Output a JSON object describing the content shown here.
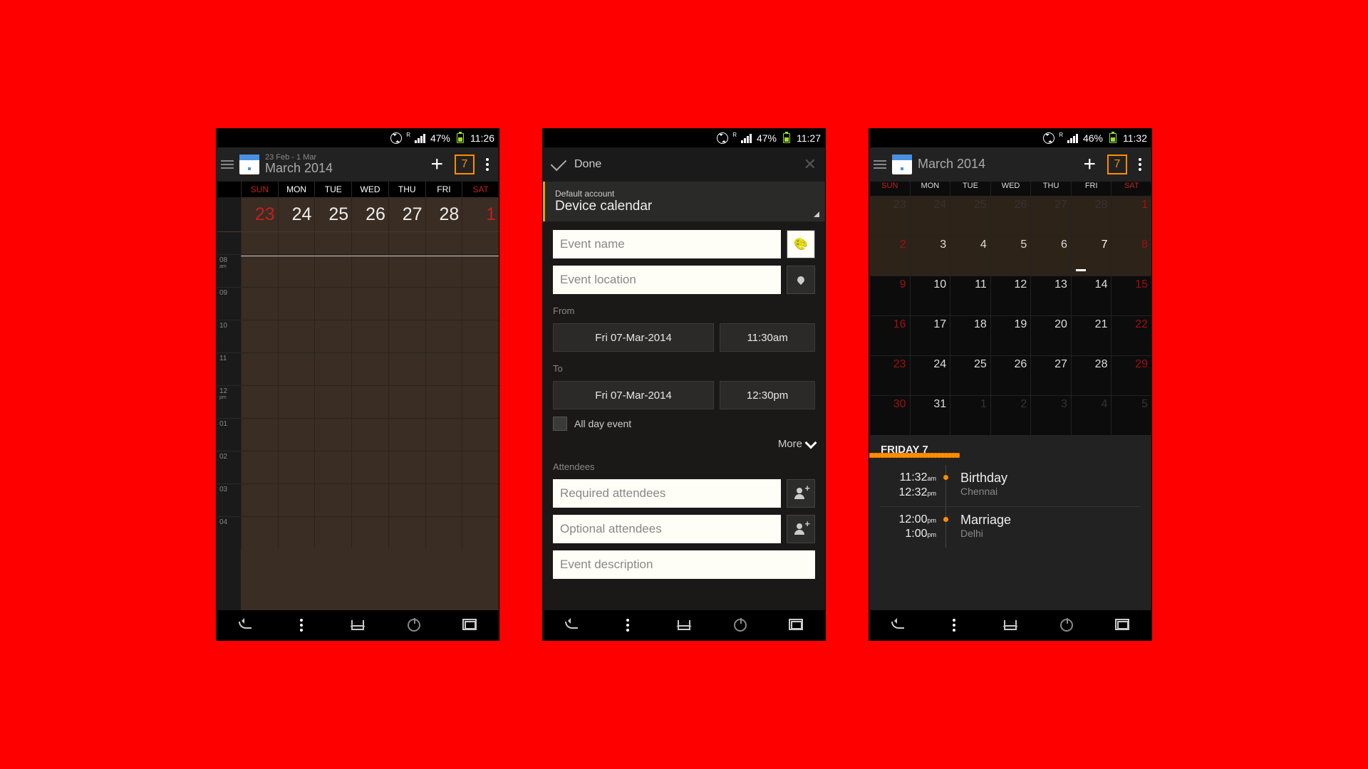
{
  "screen1": {
    "status": {
      "battery": "47%",
      "time": "11:26"
    },
    "header": {
      "sub": "23 Feb - 1 Mar",
      "main": "March 2014",
      "today": "7"
    },
    "days": [
      "SUN",
      "MON",
      "TUE",
      "WED",
      "THU",
      "FRI",
      "SAT"
    ],
    "dates": [
      "23",
      "24",
      "25",
      "26",
      "27",
      "28",
      "1"
    ],
    "hours": [
      {
        "h": "08",
        "ap": "am"
      },
      {
        "h": "09",
        "ap": ""
      },
      {
        "h": "10",
        "ap": ""
      },
      {
        "h": "11",
        "ap": ""
      },
      {
        "h": "12",
        "ap": "pm"
      },
      {
        "h": "01",
        "ap": ""
      },
      {
        "h": "02",
        "ap": ""
      },
      {
        "h": "03",
        "ap": ""
      },
      {
        "h": "04",
        "ap": ""
      }
    ]
  },
  "screen2": {
    "status": {
      "battery": "47%",
      "time": "11:27"
    },
    "done": "Done",
    "account_label": "Default account",
    "account_value": "Device calendar",
    "event_name_ph": "Event name",
    "event_loc_ph": "Event location",
    "from_label": "From",
    "to_label": "To",
    "from_date": "Fri 07-Mar-2014",
    "from_time": "11:30am",
    "to_date": "Fri 07-Mar-2014",
    "to_time": "12:30pm",
    "allday": "All day event",
    "more": "More",
    "attendees_label": "Attendees",
    "required_ph": "Required attendees",
    "optional_ph": "Optional attendees",
    "desc_ph": "Event description"
  },
  "screen3": {
    "status": {
      "battery": "46%",
      "time": "11:32"
    },
    "header": {
      "main": "March 2014",
      "today": "7"
    },
    "days": [
      "SUN",
      "MON",
      "TUE",
      "WED",
      "THU",
      "FRI",
      "SAT"
    ],
    "month_rows": [
      [
        "23",
        "24",
        "25",
        "26",
        "27",
        "28",
        "1"
      ],
      [
        "2",
        "3",
        "4",
        "5",
        "6",
        "7",
        "8"
      ],
      [
        "9",
        "10",
        "11",
        "12",
        "13",
        "14",
        "15"
      ],
      [
        "16",
        "17",
        "18",
        "19",
        "20",
        "21",
        "22"
      ],
      [
        "23",
        "24",
        "25",
        "26",
        "27",
        "28",
        "29"
      ],
      [
        "30",
        "31",
        "1",
        "2",
        "3",
        "4",
        "5"
      ]
    ],
    "agenda_title": "FRIDAY 7",
    "events": [
      {
        "t1": "11:32",
        "p1": "am",
        "t2": "12:32",
        "p2": "pm",
        "title": "Birthday",
        "loc": "Chennai"
      },
      {
        "t1": "12:00",
        "p1": "pm",
        "t2": "1:00",
        "p2": "pm",
        "title": "Marriage",
        "loc": "Delhi"
      }
    ]
  }
}
